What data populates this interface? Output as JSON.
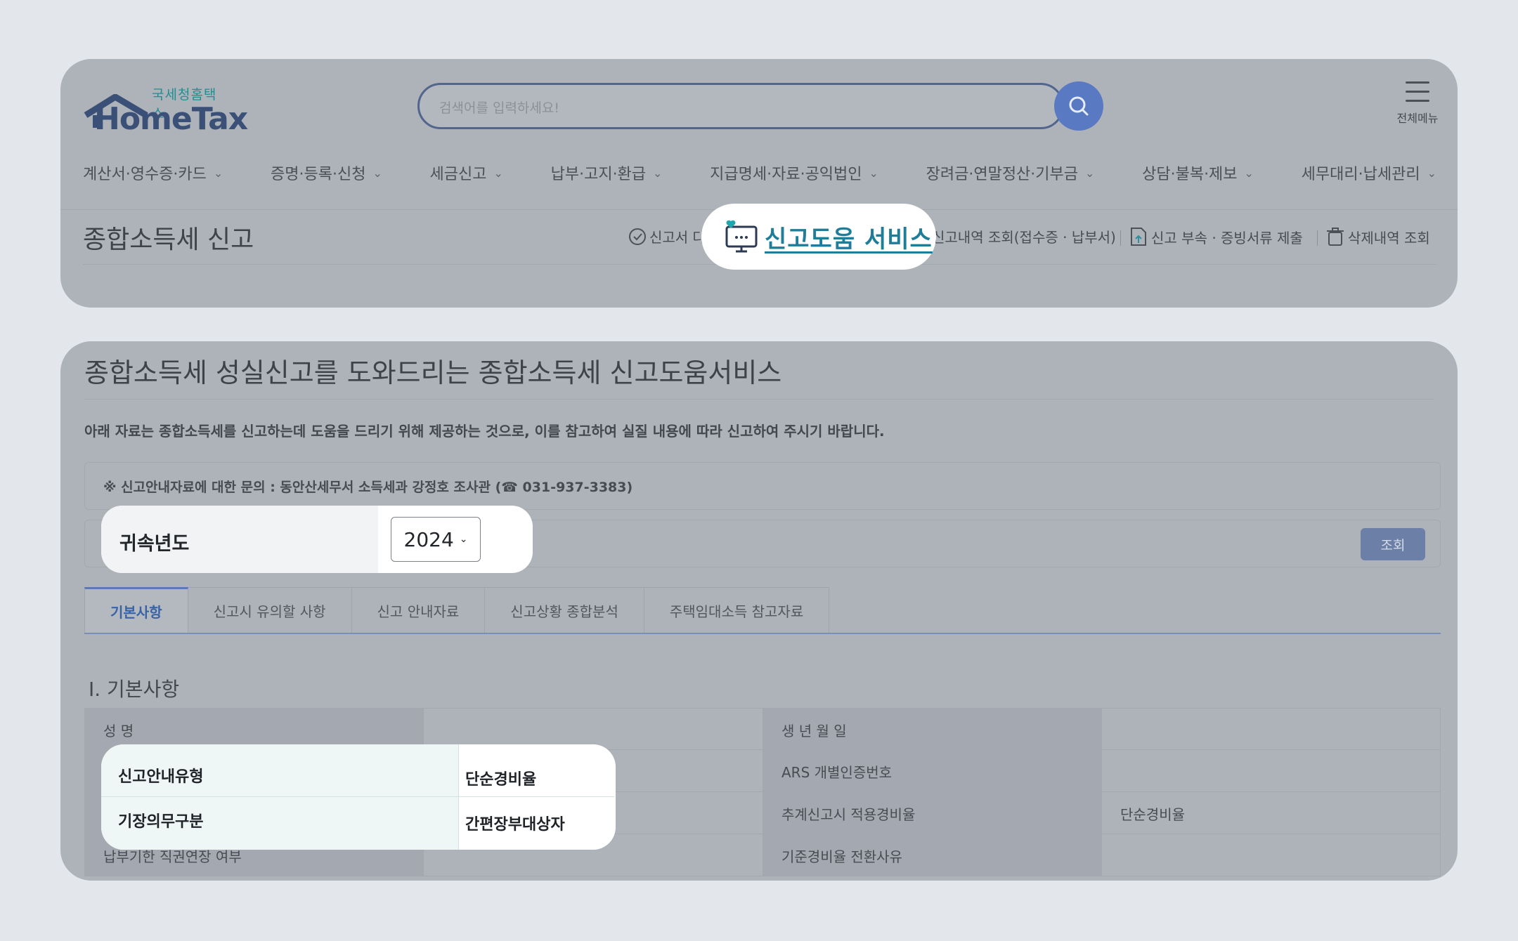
{
  "header": {
    "logo_sub": "국세청홈택스",
    "logo_main": "HomeTax",
    "search_placeholder": "검색어를 입력하세요!",
    "all_menu_label": "전체메뉴"
  },
  "gnb": [
    {
      "label": "계산서·영수증·카드"
    },
    {
      "label": "증명·등록·신청"
    },
    {
      "label": "세금신고"
    },
    {
      "label": "납부·고지·환급"
    },
    {
      "label": "지급명세·자료·공익법인"
    },
    {
      "label": "장려금·연말정산·기부금"
    },
    {
      "label": "상담·불복·제보"
    },
    {
      "label": "세무대리·납세관리"
    }
  ],
  "page": {
    "title": "종합소득세 신고",
    "quick_links": {
      "first": "신고서 다",
      "help": "신고도움 서비스",
      "history": "신고내역 조회(접수증 · 납부서)",
      "attach": "신고 부속 · 증빙서류 제출",
      "deleted": "삭제내역 조회"
    }
  },
  "main": {
    "title": "종합소득세 성실신고를 도와드리는 종합소득세 신고도움서비스",
    "notice": "아래 자료는 종합소득세를 신고하는데 도움을 드리기 위해 제공하는 것으로, 이를 참고하여 실질 내용에 따라 신고하여 주시기 바랍니다.",
    "inquiry": "※ 신고안내자료에 대한 문의 : 동안산세무서 소득세과 강정호 조사관 (☎ 031-937-3383)",
    "year_label": "귀속년도",
    "year_value": "2024",
    "query_button": "조회",
    "tabs": [
      "기본사항",
      "신고시 유의할 사항",
      "신고 안내자료",
      "신고상황 종합분석",
      "주택임대소득 참고자료"
    ],
    "section_title": "Ⅰ. 기본사항",
    "rows": [
      {
        "l1": "성      명",
        "v1": "",
        "l2": "생 년 월 일",
        "v2": ""
      },
      {
        "l1": "신고안내유형",
        "v1": "단순경비율",
        "l2": "ARS 개별인증번호",
        "v2": ""
      },
      {
        "l1": "기장의무구분",
        "v1": "간편장부대상자",
        "l2": "추계신고시 적용경비율",
        "v2": "단순경비율"
      },
      {
        "l1": "납부기한 직권연장 여부",
        "v1": "",
        "l2": "기준경비율 전환사유",
        "v2": ""
      }
    ]
  },
  "colors": {
    "accent_blue": "#5a79c3",
    "help_link": "#1f7d9a",
    "dim_overlay": "#aeb2b9"
  }
}
